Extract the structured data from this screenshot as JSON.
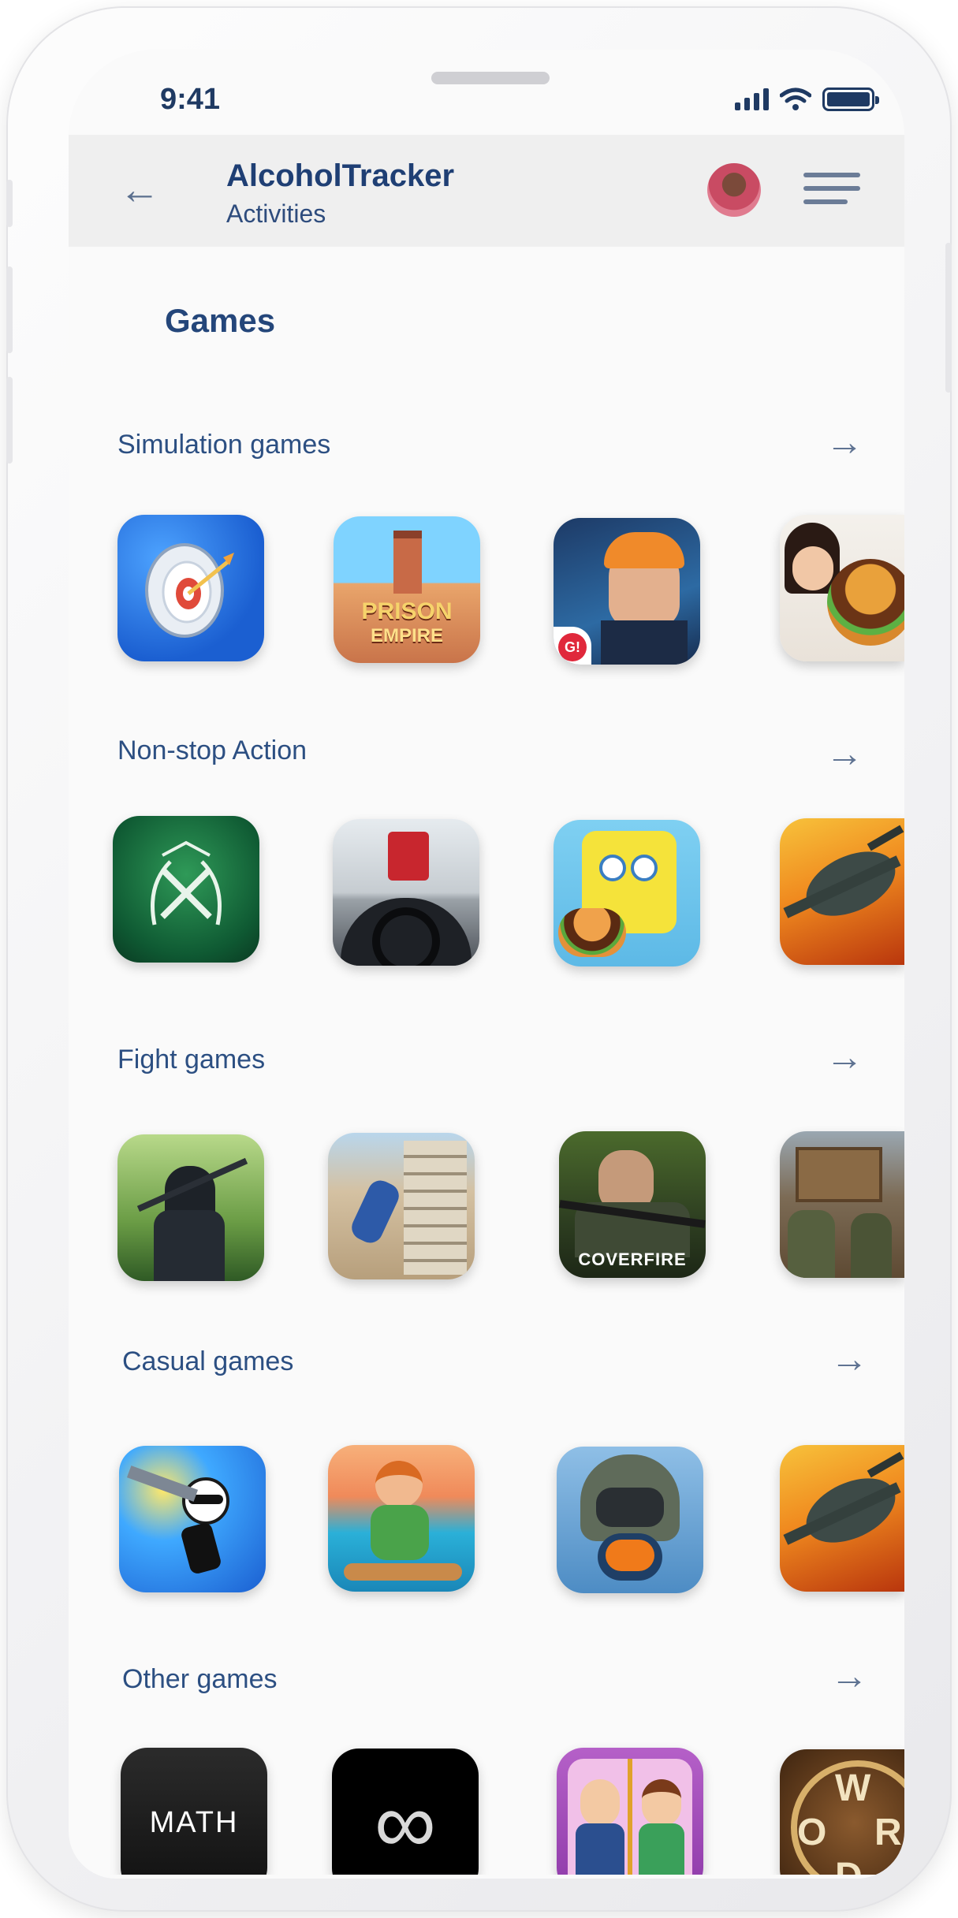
{
  "status_bar": {
    "time": "9:41"
  },
  "header": {
    "title": "AlcoholTracker",
    "subtitle": "Activities"
  },
  "page": {
    "heading": "Games"
  },
  "sections": [
    {
      "label": "Simulation games"
    },
    {
      "label": "Non-stop Action"
    },
    {
      "label": "Fight games"
    },
    {
      "label": "Casual games"
    },
    {
      "label": "Other games"
    }
  ],
  "tile_text": {
    "prison_line1": "PRISON",
    "prison_line2": "EMPIRE",
    "g_badge": "G!",
    "coverfire": "COVERFIRE",
    "math": "MATH",
    "infinity": "∞",
    "word_w": "W",
    "word_o": "O",
    "word_r": "R",
    "word_d": "D"
  },
  "icons": {
    "back": "left-arrow-icon",
    "menu": "hamburger-menu-icon",
    "section_more": "right-arrow-icon"
  },
  "colors": {
    "accent": "#24467a",
    "header_bg": "#efefef",
    "screen_bg": "#fafafa"
  }
}
